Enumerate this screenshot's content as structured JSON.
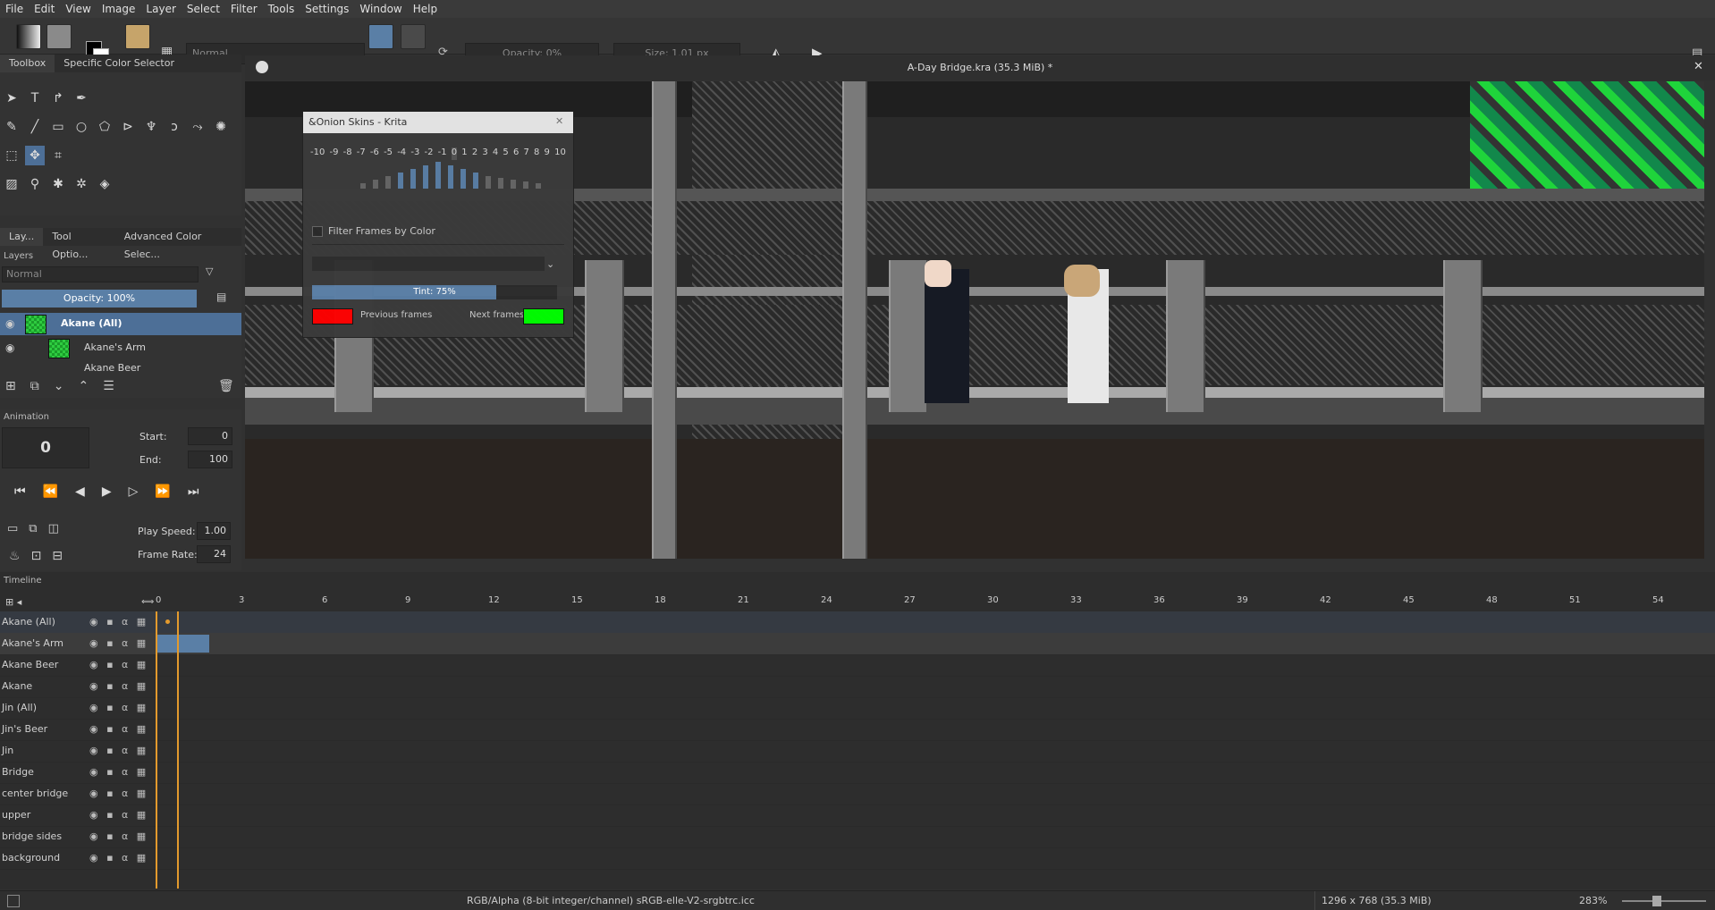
{
  "menu": [
    "File",
    "Edit",
    "View",
    "Image",
    "Layer",
    "Select",
    "Filter",
    "Tools",
    "Settings",
    "Window",
    "Help"
  ],
  "toolbar": {
    "blend_mode": "Normal",
    "opacity": "Opacity: 0%",
    "size": "Size: 1.01 px"
  },
  "document": {
    "title": "A-Day Bridge.kra (35.3 MiB) *"
  },
  "left_tabs": {
    "toolbox": "Toolbox",
    "color_selector": "Specific Color Selector"
  },
  "docker_tabs": [
    "Lay...",
    "Tool Optio...",
    "Advanced Color Selec..."
  ],
  "layers": {
    "title": "Layers",
    "blend": "Normal",
    "opacity": "Opacity:  100%",
    "items": [
      {
        "name": "Akane (All)"
      },
      {
        "name": "Akane's Arm"
      },
      {
        "name": "Akane Beer"
      }
    ]
  },
  "animation": {
    "title": "Animation",
    "frame": "0",
    "start_label": "Start:",
    "start": "0",
    "end_label": "End:",
    "end": "100",
    "speed_label": "Play Speed:",
    "speed": "1.00",
    "rate_label": "Frame Rate:",
    "rate": "24"
  },
  "onion": {
    "title": "&Onion Skins - Krita",
    "numbers": [
      "-10",
      "-9",
      "-8",
      "-7",
      "-6",
      "-5",
      "-4",
      "-3",
      "-2",
      "-1",
      "0",
      "1",
      "2",
      "3",
      "4",
      "5",
      "6",
      "7",
      "8",
      "9",
      "10"
    ],
    "filter_label": "Filter Frames by Color",
    "tint": "Tint: 75%",
    "tint_value": 0.75,
    "prev_label": "Previous frames",
    "next_label": "Next frames",
    "prev_color": "#ff0000",
    "next_color": "#00ff00"
  },
  "timeline": {
    "title": "Timeline",
    "ruler": [
      "0",
      "3",
      "6",
      "9",
      "12",
      "15",
      "18",
      "21",
      "24",
      "27",
      "30",
      "33",
      "36",
      "39",
      "42",
      "45",
      "48",
      "51",
      "54"
    ],
    "layers": [
      "Akane (All)",
      "Akane's Arm",
      "Akane Beer",
      "Akane",
      "Jin (All)",
      "Jin's Beer",
      "Jin",
      "Bridge",
      "center bridge",
      "upper",
      "bridge sides",
      "background"
    ]
  },
  "status": {
    "color_space": "RGB/Alpha (8-bit integer/channel)  sRGB-elle-V2-srgbtrc.icc",
    "dimensions": "1296 x 768 (35.3 MiB)",
    "zoom": "283%"
  }
}
